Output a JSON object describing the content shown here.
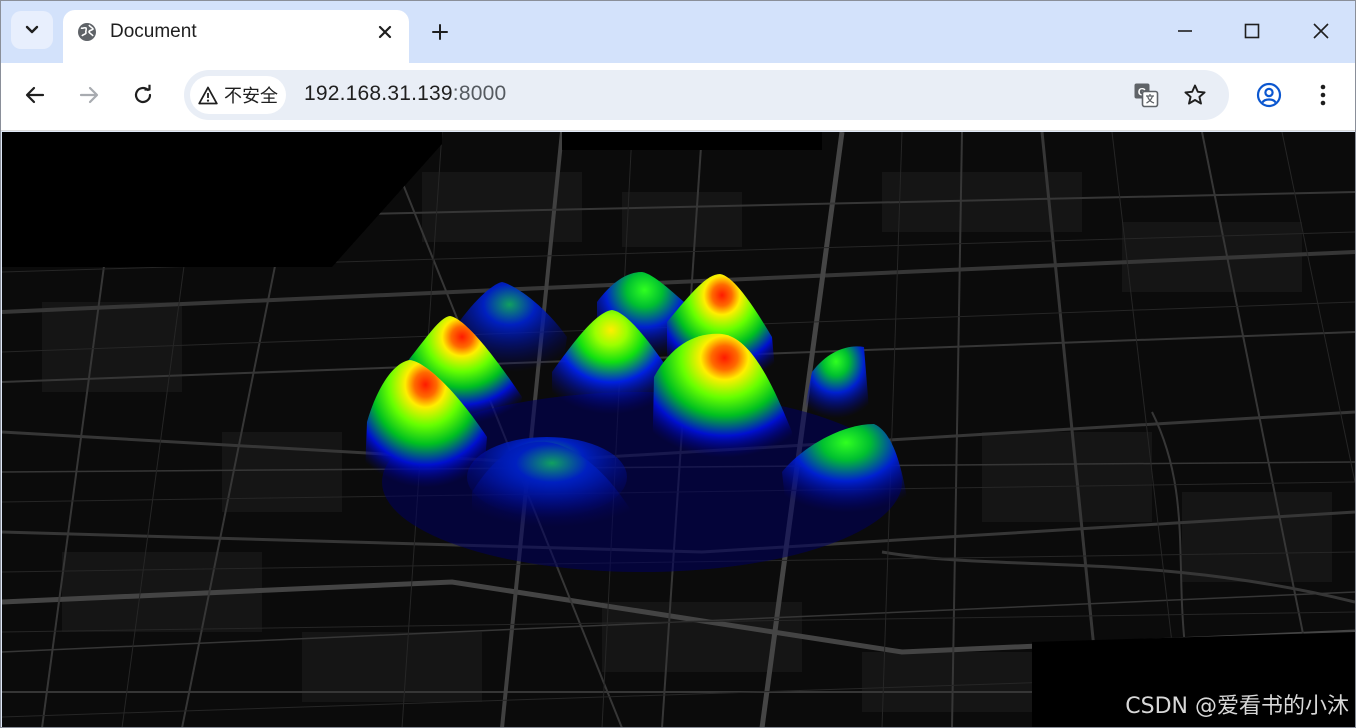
{
  "browser": {
    "tab": {
      "title": "Document"
    },
    "address": {
      "security_label": "不安全",
      "host": "192.168.31.139",
      "port": ":8000"
    },
    "icons": {
      "tab_search": "chevron-down-icon",
      "favicon": "globe-icon",
      "close_tab": "close-icon",
      "new_tab": "plus-icon",
      "back": "arrow-left-icon",
      "forward": "arrow-right-icon",
      "reload": "reload-icon",
      "warning": "warning-triangle-icon",
      "translate": "translate-icon",
      "bookmark": "star-icon",
      "profile": "profile-icon",
      "menu": "kebab-menu-icon",
      "minimize": "minimize-icon",
      "maximize": "maximize-icon",
      "close_window": "close-window-icon"
    },
    "colors": {
      "tabstrip": "#d3e2fb",
      "omnibox": "#e9eef6",
      "profile_accent": "#0b57d0"
    }
  },
  "page": {
    "map": {
      "theme": "dark",
      "background": "#0b0b0b",
      "road_color": "#3a3a3a"
    },
    "heatmap": {
      "type": "3d-heatmap",
      "color_ramp": [
        "#00008b",
        "#0000ff",
        "#00ff00",
        "#ffff00",
        "#ff0000"
      ]
    },
    "watermark": "CSDN @爱看书的小沐"
  }
}
